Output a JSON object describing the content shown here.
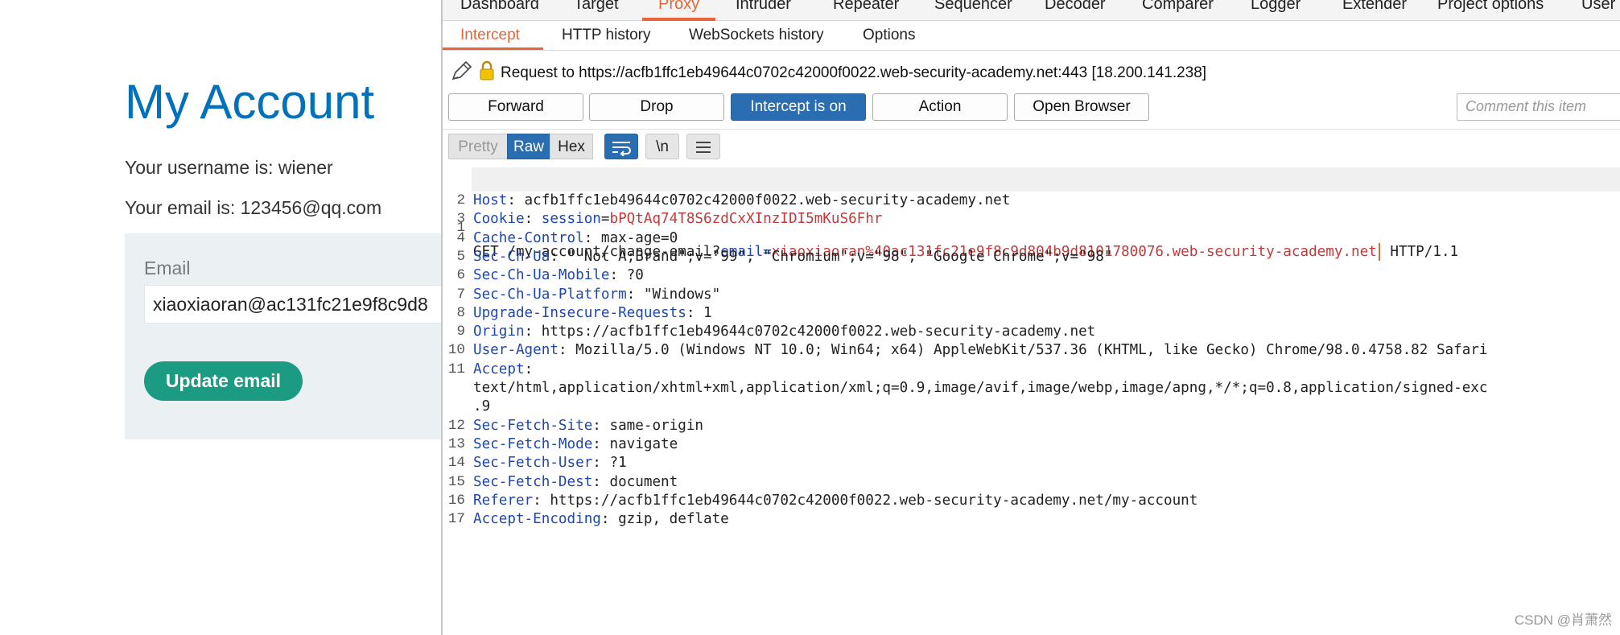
{
  "webpage": {
    "title": "My Account",
    "username_line": "Your username is: wiener",
    "email_line": "Your email is: 123456@qq.com",
    "form": {
      "label": "Email",
      "input_value": "xiaoxiaoran@ac131fc21e9f8c9d8",
      "submit_label": "Update email"
    }
  },
  "burp": {
    "main_tabs": [
      "Dashboard",
      "Target",
      "Proxy",
      "Intruder",
      "Repeater",
      "Sequencer",
      "Decoder",
      "Comparer",
      "Logger",
      "Extender",
      "Project options",
      "User o"
    ],
    "active_main_tab": "Proxy",
    "sub_tabs": [
      "Intercept",
      "HTTP history",
      "WebSockets history",
      "Options"
    ],
    "active_sub_tab": "Intercept",
    "request_label": "Request to https://acfb1ffc1eb49644c0702c42000f0022.web-security-academy.net:443  [18.200.141.238]",
    "buttons": {
      "forward": "Forward",
      "drop": "Drop",
      "intercept": "Intercept is on",
      "action": "Action",
      "open_browser": "Open Browser"
    },
    "comment_placeholder": "Comment this item",
    "view_buttons": {
      "pretty": "Pretty",
      "raw": "Raw",
      "hex": "Hex",
      "newline": "\\n"
    },
    "active_view": "Raw",
    "request": {
      "line1": {
        "num": "1",
        "method_path": "GET /my-account/change-email?",
        "param": "email",
        "eq": "=",
        "param_value": "xiaoxiaoran%40ac131fc21e9f8c9d804b9d8101780076.web-security-academy.net",
        "protocol": " HTTP/1.1"
      },
      "headers": [
        {
          "num": "2",
          "name": "Host",
          "value": ": acfb1ffc1eb49644c0702c42000f0022.web-security-academy.net"
        },
        {
          "num": "3",
          "name": "Cookie",
          "value": ": ",
          "cookie_name": "session",
          "cookie_eq": "=",
          "cookie_value": "bPQtAq74T8S6zdCxXInzIDI5mKuS6Fhr"
        },
        {
          "num": "4",
          "name": "Cache-Control",
          "value": ": max-age=0"
        },
        {
          "num": "5",
          "name": "Sec-Ch-Ua",
          "value": ": \" Not A;Brand\";v=\"99\", \"Chromium\";v=\"98\", \"Google Chrome\";v=\"98\""
        },
        {
          "num": "6",
          "name": "Sec-Ch-Ua-Mobile",
          "value": ": ?0"
        },
        {
          "num": "7",
          "name": "Sec-Ch-Ua-Platform",
          "value": ": \"Windows\""
        },
        {
          "num": "8",
          "name": "Upgrade-Insecure-Requests",
          "value": ": 1"
        },
        {
          "num": "9",
          "name": "Origin",
          "value": ": https://acfb1ffc1eb49644c0702c42000f0022.web-security-academy.net"
        },
        {
          "num": "10",
          "name": "User-Agent",
          "value": ": Mozilla/5.0 (Windows NT 10.0; Win64; x64) AppleWebKit/537.36 (KHTML, like Gecko) Chrome/98.0.4758.82 Safari"
        },
        {
          "num": "11",
          "name": "Accept",
          "value": ":"
        },
        {
          "num": "",
          "name": "",
          "value": "text/html,application/xhtml+xml,application/xml;q=0.9,image/avif,image/webp,image/apng,*/*;q=0.8,application/signed-exc"
        },
        {
          "num": "",
          "name": "",
          "value": ".9"
        },
        {
          "num": "12",
          "name": "Sec-Fetch-Site",
          "value": ": same-origin"
        },
        {
          "num": "13",
          "name": "Sec-Fetch-Mode",
          "value": ": navigate"
        },
        {
          "num": "14",
          "name": "Sec-Fetch-User",
          "value": ": ?1"
        },
        {
          "num": "15",
          "name": "Sec-Fetch-Dest",
          "value": ": document"
        },
        {
          "num": "16",
          "name": "Referer",
          "value": ": https://acfb1ffc1eb49644c0702c42000f0022.web-security-academy.net/my-account"
        },
        {
          "num": "17",
          "name": "Accept-Encoding",
          "value": ": gzip, deflate"
        }
      ]
    }
  },
  "watermark": "CSDN @肖萧然",
  "colors": {
    "accent": "#e8643a",
    "primary_blue": "#2a6db0",
    "web_title": "#0071bc",
    "web_button": "#1b9b82",
    "header_name": "#1f47b0",
    "param_value": "#c23a3a"
  }
}
